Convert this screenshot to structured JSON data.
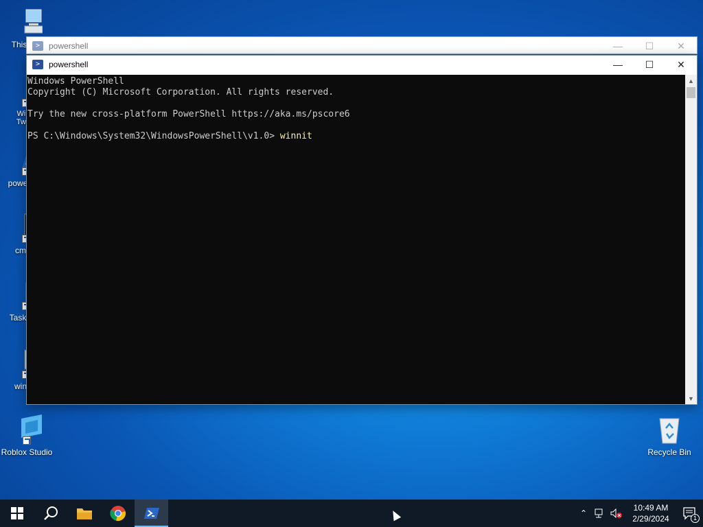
{
  "desktop": {
    "icons": [
      {
        "label": "This",
        "icon": "computer-icon"
      },
      {
        "label": "Win Twe",
        "icon": "tweaker-icon"
      },
      {
        "label": "powe",
        "icon": "powershell-shortcut-icon"
      },
      {
        "label": "cm",
        "icon": "cmd-icon"
      },
      {
        "label": "Task",
        "icon": "task-manager-icon"
      },
      {
        "label": "win",
        "icon": "winnit-icon"
      },
      {
        "label": "Roblox Studio",
        "icon": "roblox-studio-icon"
      },
      {
        "label": "Recycle Bin",
        "icon": "recycle-bin-icon"
      }
    ]
  },
  "back_window": {
    "title": "powershell"
  },
  "front_window": {
    "title": "powershell",
    "console_lines": [
      "Windows PowerShell",
      "Copyright (C) Microsoft Corporation. All rights reserved.",
      "",
      "Try the new cross-platform PowerShell https://aka.ms/pscore6",
      ""
    ],
    "prompt": "PS C:\\Windows\\System32\\WindowsPowerShell\\v1.0> ",
    "command": "winnit"
  },
  "taskbar": {
    "items": [
      "start-button",
      "search-button",
      "file-explorer-button",
      "chrome-button",
      "powershell-taskbar-button"
    ],
    "time": "10:49 AM",
    "date": "2/29/2024",
    "notification_count": "1"
  },
  "colors": {
    "console_bg": "#0c0c0c",
    "console_fg": "#cccccc",
    "command": "#f9f1a5",
    "taskbar": "#101a26"
  }
}
